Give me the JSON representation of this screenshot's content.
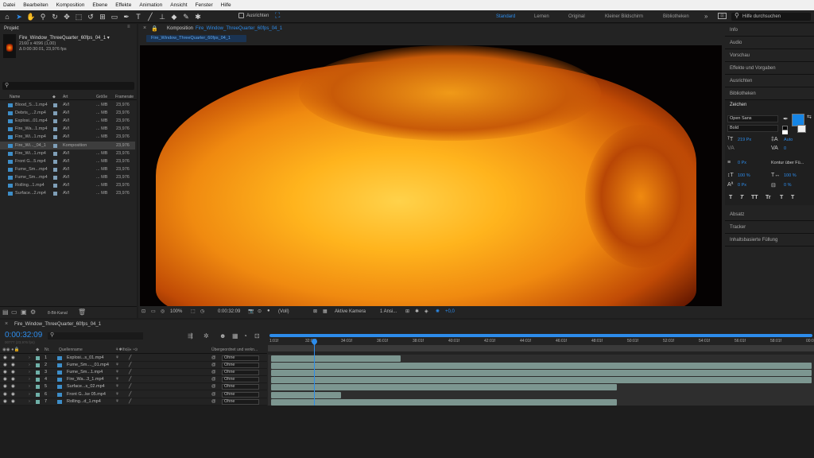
{
  "menubar": [
    "Datei",
    "Bearbeiten",
    "Komposition",
    "Ebene",
    "Effekte",
    "Animation",
    "Ansicht",
    "Fenster",
    "Hilfe"
  ],
  "toolbar": {
    "align_label": "Ausrichten",
    "workspaces": [
      "Standard",
      "Lernen",
      "Original",
      "Kleiner Bildschirm",
      "Bibliotheken"
    ],
    "active_workspace": "Standard",
    "help_placeholder": "Hilfe durchsuchen"
  },
  "project": {
    "tab": "Projekt",
    "selected_name": "Fire_Window_ThreeQuarter_60fps_04_1 ▾",
    "selected_dims": "2160 x 4096 (1,00)",
    "selected_duration": "Δ 0:00:30:01, 23,976 fps",
    "columns": [
      "Name",
      "Art",
      "Größe",
      "Framerate"
    ],
    "items": [
      {
        "name": "Blood_S...1.mp4",
        "type": "AVI",
        "size": "... MB",
        "fps": "23,976"
      },
      {
        "name": "Debris_...2.mp4",
        "type": "AVI",
        "size": "... MB",
        "fps": "23,976"
      },
      {
        "name": "Explosi...01.mp4",
        "type": "AVI",
        "size": "... MB",
        "fps": "23,976"
      },
      {
        "name": "Fire_Wa...1.mp4",
        "type": "AVI",
        "size": "... MB",
        "fps": "23,976"
      },
      {
        "name": "Fire_Wi...1.mp4",
        "type": "AVI",
        "size": "... MB",
        "fps": "23,976"
      },
      {
        "name": "Fire_Wi..._04_1",
        "type": "Komposition",
        "size": "",
        "fps": "23,976"
      },
      {
        "name": "Fire_Wi...1.mp4",
        "type": "AVI",
        "size": "... MB",
        "fps": "23,976"
      },
      {
        "name": "Front G...5.mp4",
        "type": "AVI",
        "size": "... MB",
        "fps": "23,976"
      },
      {
        "name": "Fume_Sm...mp4",
        "type": "AVI",
        "size": "... MB",
        "fps": "23,976"
      },
      {
        "name": "Fume_Sm...mp4",
        "type": "AVI",
        "size": "... MB",
        "fps": "23,976"
      },
      {
        "name": "Rolling...1.mp4",
        "type": "AVI",
        "size": "... MB",
        "fps": "23,976"
      },
      {
        "name": "Surface...2.mp4",
        "type": "AVI",
        "size": "... MB",
        "fps": "23,976"
      }
    ],
    "bit_depth": "8-Bit-Kanal"
  },
  "composition": {
    "tab_prefix": "Komposition",
    "tab_name": "Fire_Window_ThreeQuarter_60fps_04_1",
    "sub_tab": "Fire_Window_ThreeQuarter_60fps_04_1",
    "zoom": "100%",
    "timecode": "0:00:32:09",
    "resolution": "(Voll)",
    "camera": "Aktive Kamera",
    "views": "1 Ansi...",
    "exposure": "+0,0"
  },
  "right_panels": {
    "top": [
      "Info",
      "Audio",
      "Vorschau",
      "Effekte und Vorgaben",
      "Ausrichten",
      "Bibliotheken"
    ],
    "character": {
      "title": "Zeichen",
      "font": "Open Sans",
      "style": "Bold",
      "font_size": "219 Px",
      "leading": "Auto",
      "tracking": "0",
      "stroke_width": "0 Px",
      "stroke_mode": "Kontur über Fü...",
      "vscale": "100 %",
      "hscale": "100 %",
      "baseline": "0 Px",
      "tsume": "0 %",
      "text_buttons": [
        "T",
        "T",
        "TT",
        "Tr",
        "T",
        "T"
      ],
      "fill_color": "#1685e5"
    },
    "bottom": [
      "Absatz",
      "Tracker",
      "Inhaltsbasierte Füllung"
    ]
  },
  "timeline": {
    "tab": "Fire_Window_ThreeQuarter_60fps_04_1",
    "timecode": "0:00:32:09",
    "timecode_sub": "00777 (23,976 fps)",
    "col_num": "Nr.",
    "col_source": "Quellenname",
    "col_parent": "Übergeordnet und verkn...",
    "ruler": [
      "1:01f",
      "32:01f",
      "34:01f",
      "36:01f",
      "38:01f",
      "40:01f",
      "42:01f",
      "44:01f",
      "46:01f",
      "48:01f",
      "50:01f",
      "52:01f",
      "54:01f",
      "56:01f",
      "58:01f",
      "00:01"
    ],
    "layers": [
      {
        "num": "1",
        "name": "Explosi...s_01.mp4",
        "parent": "Ohne",
        "bar_end": 0.24
      },
      {
        "num": "2",
        "name": "Fume_Sm...._01.mp4",
        "parent": "Ohne",
        "bar_end": 1.0
      },
      {
        "num": "3",
        "name": "Fume_Sm...1.mp4",
        "parent": "Ohne",
        "bar_end": 1.0
      },
      {
        "num": "4",
        "name": "Fire_Wa...3_1.mp4",
        "parent": "Ohne",
        "bar_end": 1.0
      },
      {
        "num": "5",
        "name": "Surface...s_02.mp4",
        "parent": "Ohne",
        "bar_end": 0.64
      },
      {
        "num": "6",
        "name": "Front G...ke 05.mp4",
        "parent": "Ohne",
        "bar_end": 0.13
      },
      {
        "num": "7",
        "name": "Rolling...d_1.mp4",
        "parent": "Ohne",
        "bar_end": 0.64
      }
    ],
    "playhead": 0.08
  },
  "colors": {
    "accent": "#2d8ceb",
    "panel": "#232323",
    "bg": "#1d1d1d",
    "clip": "#7c9690"
  }
}
